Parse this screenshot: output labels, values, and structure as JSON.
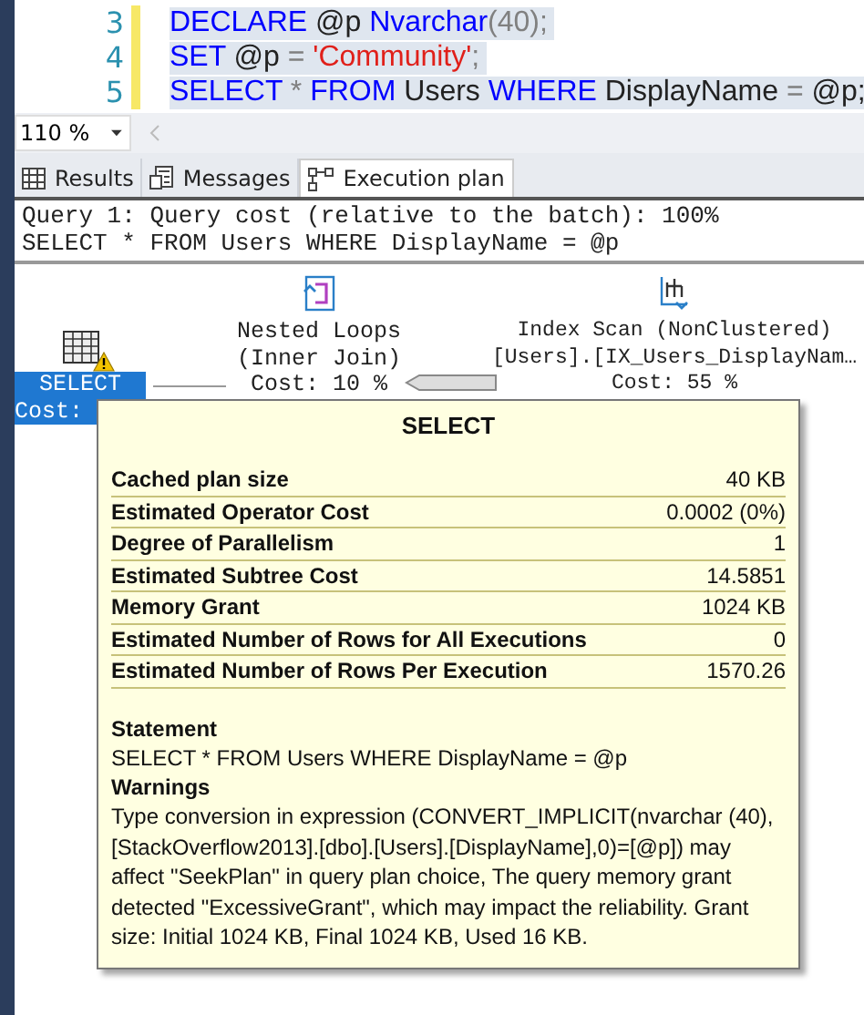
{
  "editor": {
    "lines": [
      {
        "number": "3",
        "tokens": [
          {
            "kind": "keyword",
            "text": "DECLARE"
          },
          {
            "kind": "plain",
            "text": " @p "
          },
          {
            "kind": "keyword",
            "text": "Nvarchar"
          },
          {
            "kind": "punct",
            "text": "(40);"
          }
        ],
        "selected": true
      },
      {
        "number": "4",
        "tokens": [
          {
            "kind": "keyword",
            "text": "SET"
          },
          {
            "kind": "plain",
            "text": " @p "
          },
          {
            "kind": "punct",
            "text": "= "
          },
          {
            "kind": "string",
            "text": "'Community'"
          },
          {
            "kind": "punct",
            "text": ";"
          }
        ],
        "selected": true
      },
      {
        "number": "5",
        "tokens": [
          {
            "kind": "keyword",
            "text": "SELECT"
          },
          {
            "kind": "punct",
            "text": " * "
          },
          {
            "kind": "keyword",
            "text": "FROM"
          },
          {
            "kind": "plain",
            "text": " Users "
          },
          {
            "kind": "keyword",
            "text": "WHERE"
          },
          {
            "kind": "plain",
            "text": " DisplayName "
          },
          {
            "kind": "punct",
            "text": "= "
          },
          {
            "kind": "plain",
            "text": "@p;"
          }
        ],
        "selected": true
      }
    ]
  },
  "zoom": {
    "value": "110 %"
  },
  "tabs": [
    {
      "label": "Results",
      "kind": "grid",
      "selected": false
    },
    {
      "label": "Messages",
      "kind": "doc",
      "selected": false
    },
    {
      "label": "Execution plan",
      "kind": "plan",
      "selected": true
    }
  ],
  "plan": {
    "header": [
      "Query 1: Query cost (relative to the batch): 100%",
      "SELECT * FROM Users WHERE DisplayName = @p"
    ],
    "nodes": [
      {
        "kind": "select",
        "lines": [
          "SELECT",
          "Cost:"
        ],
        "selected": true,
        "warning": true
      },
      {
        "kind": "loops",
        "lines": [
          "Nested Loops",
          "(Inner Join)",
          "Cost: 10 %"
        ],
        "selected": false,
        "warning": false
      },
      {
        "kind": "scan",
        "lines": [
          "Index Scan (NonClustered)",
          "[Users].[IX_Users_DisplayNam…",
          "Cost: 55 %"
        ],
        "selected": false,
        "warning": false
      }
    ]
  },
  "tooltip": {
    "title": "SELECT",
    "properties": [
      {
        "name": "Cached plan size",
        "value": "40 KB"
      },
      {
        "name": "Estimated Operator Cost",
        "value": "0.0002 (0%)"
      },
      {
        "name": "Degree of Parallelism",
        "value": "1"
      },
      {
        "name": "Estimated Subtree Cost",
        "value": "14.5851"
      },
      {
        "name": "Memory Grant",
        "value": "1024 KB"
      },
      {
        "name": "Estimated Number of Rows for All Executions",
        "value": "0"
      },
      {
        "name": "Estimated Number of Rows Per Execution",
        "value": "1570.26"
      }
    ],
    "sections": [
      {
        "heading": "Statement",
        "text": "SELECT * FROM Users WHERE DisplayName = @p"
      },
      {
        "heading": "Warnings",
        "text": "Type conversion in expression (CONVERT_IMPLICIT(nvarchar (40),[StackOverflow2013].[dbo].[Users].[DisplayName],0)=[@p]) may affect \"SeekPlan\" in query plan choice, The query memory grant detected \"ExcessiveGrant\", which may impact the reliability. Grant size: Initial 1024 KB, Final 1024 KB, Used 16 KB."
      }
    ]
  }
}
